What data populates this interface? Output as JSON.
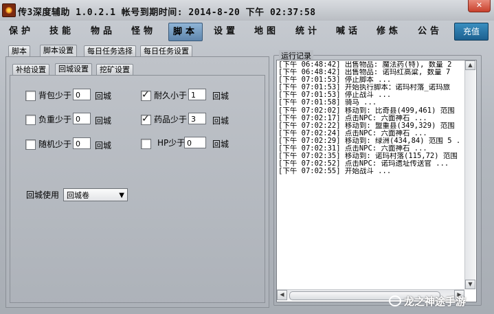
{
  "window": {
    "title": "传3深度辅助  1.0.2.1  帐号到期时间: 2014-8-20 下午 02:37:58",
    "close_label": "✕"
  },
  "menu": {
    "items": [
      "保护",
      "技能",
      "物品",
      "怪物",
      "脚本",
      "设置",
      "地图",
      "统计",
      "喊话",
      "修炼",
      "公告"
    ],
    "active": "脚本",
    "charge_label": "充值"
  },
  "tabs_main": [
    "脚本",
    "脚本设置",
    "每日任务选择",
    "每日任务设置"
  ],
  "tabs_sub": [
    "补给设置",
    "回城设置",
    "挖矿设置"
  ],
  "return_settings": {
    "rows": [
      {
        "checked": false,
        "label": "背包少于",
        "value": "0",
        "suffix": "回城"
      },
      {
        "checked": true,
        "label": "耐久小于",
        "value": "1",
        "suffix": "回城"
      },
      {
        "checked": false,
        "label": "负重少于",
        "value": "0",
        "suffix": "回城"
      },
      {
        "checked": true,
        "label": "药品少于",
        "value": "3",
        "suffix": "回城"
      },
      {
        "checked": false,
        "label": "随机少于",
        "value": "0",
        "suffix": "回城"
      },
      {
        "checked": false,
        "label": "HP少于",
        "value": "0",
        "suffix": "回城"
      }
    ],
    "use_label": "回城使用",
    "use_value": "回城卷"
  },
  "log": {
    "title": "运行记录",
    "lines": [
      "[下午 06:48:42] 出售物品: 魔法药(特), 数量 2",
      "[下午 06:48:42] 出售物品: 诺玛红高粱, 数量 7",
      "[下午 07:01:53] 停止脚本 ...",
      "[下午 07:01:53] 开始执行脚本：诺玛村落_诺玛旅",
      "[下午 07:01:53] 停止战斗 ...",
      "[下午 07:01:58] 骑马 ...",
      "[下午 07:02:02] 移动到: 比奇县(499,461) 范围",
      "[下午 07:02:17] 点击NPC: 六面神石 ...",
      "[下午 07:02:22] 移动到: 盟重县(349,329) 范围",
      "[下午 07:02:24] 点击NPC: 六面神石 ...",
      "[下午 07:02:29] 移动到: 绿洲(434,84) 范围 5 .",
      "[下午 07:02:31] 点击NPC: 六面神石 ...",
      "[下午 07:02:35] 移动到: 诺玛村落(115,72) 范围",
      "[下午 07:02:52] 点击NPC: 诺玛遗址传送官 ...",
      "[下午 07:02:55] 开始战斗 ..."
    ]
  },
  "watermark": "龙之神途手游"
}
